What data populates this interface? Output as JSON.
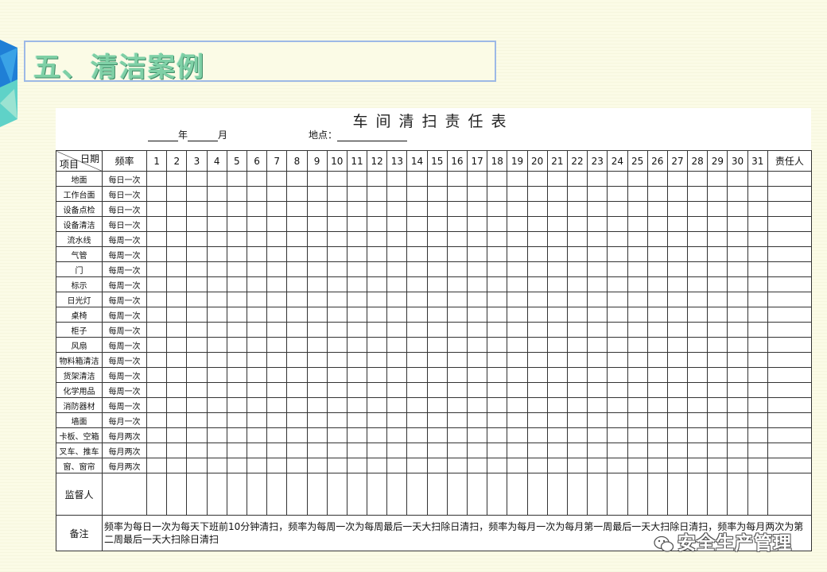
{
  "slide": {
    "heading": "五、清洁案例",
    "accent_colors": [
      "#1f7fd6",
      "#5fd2c8",
      "#9db9e6"
    ]
  },
  "sheet": {
    "title": "车间清扫责任表",
    "year_label": "年",
    "month_label": "月",
    "location_label": "地点："
  },
  "table": {
    "corner_date": "日期",
    "corner_item": "项目",
    "freq_header": "频率",
    "days": [
      "1",
      "2",
      "3",
      "4",
      "5",
      "6",
      "7",
      "8",
      "9",
      "10",
      "11",
      "12",
      "13",
      "14",
      "15",
      "16",
      "17",
      "18",
      "19",
      "20",
      "21",
      "22",
      "23",
      "24",
      "25",
      "26",
      "27",
      "28",
      "29",
      "30",
      "31"
    ],
    "responsible_header": "责任人",
    "rows": [
      {
        "item": "地面",
        "freq": "每日一次"
      },
      {
        "item": "工作台面",
        "freq": "每日一次"
      },
      {
        "item": "设备点检",
        "freq": "每日一次"
      },
      {
        "item": "设备清洁",
        "freq": "每日一次"
      },
      {
        "item": "流水线",
        "freq": "每周一次"
      },
      {
        "item": "气管",
        "freq": "每周一次"
      },
      {
        "item": "门",
        "freq": "每周一次"
      },
      {
        "item": "标示",
        "freq": "每周一次"
      },
      {
        "item": "日光灯",
        "freq": "每周一次"
      },
      {
        "item": "桌椅",
        "freq": "每周一次"
      },
      {
        "item": "柜子",
        "freq": "每周一次"
      },
      {
        "item": "风扇",
        "freq": "每周一次"
      },
      {
        "item": "物料箱清洁",
        "freq": "每周一次"
      },
      {
        "item": "货架清洁",
        "freq": "每周一次"
      },
      {
        "item": "化学用品",
        "freq": "每周一次"
      },
      {
        "item": "消防器材",
        "freq": "每周一次"
      },
      {
        "item": "墙面",
        "freq": "每月一次"
      },
      {
        "item": "卡板、空箱",
        "freq": "每月两次"
      },
      {
        "item": "叉车、推车",
        "freq": "每月两次"
      },
      {
        "item": "窗、窗帘",
        "freq": "每月两次"
      }
    ],
    "supervisor_label": "监督人",
    "note_label": "备注",
    "note_text": "频率为每日一次为每天下班前10分钟清扫，频率为每周一次为每周最后一天大扫除日清扫，频率为每月一次为每月第一周最后一天大扫除日清扫，频率为每月两次为第二周最后一天大扫除日清扫"
  },
  "watermark": {
    "text": "安全生产管理",
    "icon": "wechat-icon"
  }
}
